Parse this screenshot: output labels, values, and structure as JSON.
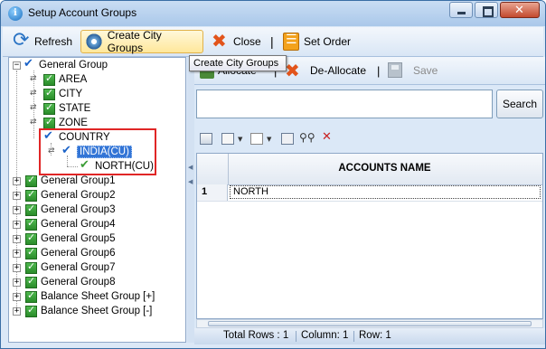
{
  "window": {
    "title": "Setup Account Groups",
    "minimize": "minimize",
    "maximize": "maximize",
    "close": "close"
  },
  "toolbar": {
    "refresh_label": "Refresh",
    "create_city_groups_label": "Create City Groups",
    "close_label": "Close",
    "set_order_label": "Set Order",
    "separator": "|"
  },
  "tooltip": {
    "text": "Create City Groups"
  },
  "tree": {
    "root": "General Group",
    "children": [
      "AREA",
      "CITY",
      "STATE",
      "ZONE",
      "COUNTRY"
    ],
    "country_child": "INDIA(CU)",
    "india_child": "NORTH(CU)",
    "siblings": [
      "General Group1",
      "General Group2",
      "General Group3",
      "General Group4",
      "General Group5",
      "General Group6",
      "General Group7",
      "General Group8",
      "Balance Sheet Group [+]",
      "Balance Sheet Group [-]"
    ]
  },
  "right_toolbar": {
    "allocate_label": "Allocate",
    "separator": "|",
    "deallocate_label": "De-Allocate",
    "save_label": "Save"
  },
  "search": {
    "value": "",
    "button_label": "Search"
  },
  "grid": {
    "column_header": "ACCOUNTS NAME",
    "rows": [
      {
        "num": "1",
        "name": "NORTH"
      }
    ]
  },
  "status": {
    "total_rows": "Total Rows : 1",
    "column": "Column: 1",
    "row": "Row: 1"
  },
  "colors": {
    "accent": "#3375d6",
    "highlight_box": "#e02626",
    "checkbox_green": "#3a9c3a"
  },
  "icons": [
    "refresh-icon",
    "gear-icon",
    "close-icon",
    "set-order-icon",
    "checkbox-icon",
    "tick-icon",
    "expand-icon",
    "collapse-icon",
    "allocate-icon",
    "deallocate-icon",
    "save-icon",
    "binoculars-icon",
    "delete-icon"
  ]
}
